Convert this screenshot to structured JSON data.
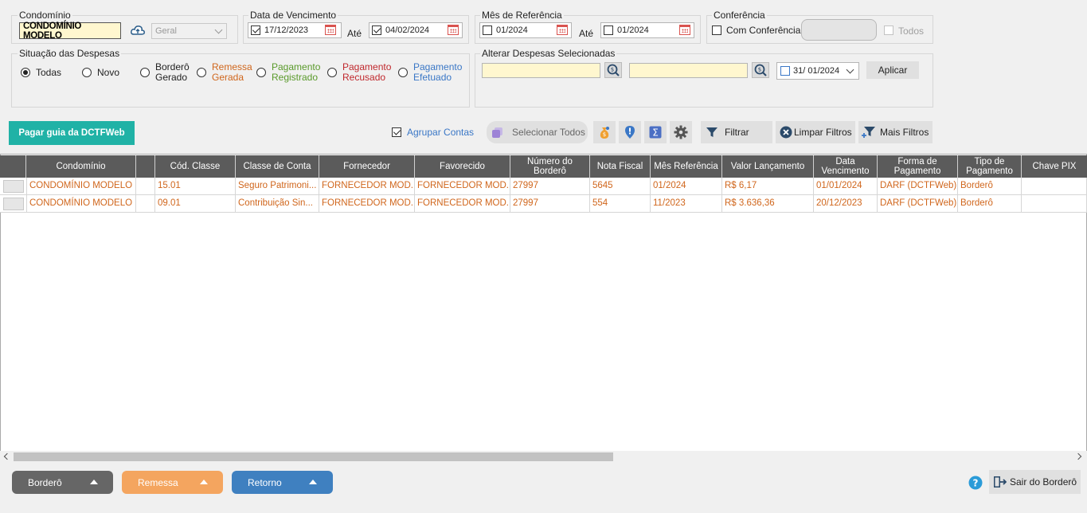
{
  "filters": {
    "condominio": {
      "label": "Condomínio",
      "value": "CONDOMÍNIO MODELO",
      "combo": "Geral"
    },
    "vencimento": {
      "label": "Data de Vencimento",
      "from": "17/12/2023",
      "ate": "Até",
      "to": "04/02/2024"
    },
    "referencia": {
      "label": "Mês de Referência",
      "from": "01/2024",
      "ate": "Até",
      "to": "01/2024"
    },
    "conferencia": {
      "label": "Conferência",
      "com": "Com Conferência",
      "todos": "Todos"
    }
  },
  "situacao": {
    "label": "Situação das Despesas",
    "options": [
      {
        "line1": "Todas",
        "line2": "",
        "color": "#222222"
      },
      {
        "line1": "Novo",
        "line2": "",
        "color": "#222222"
      },
      {
        "line1": "Borderô",
        "line2": "Gerado",
        "color": "#222222"
      },
      {
        "line1": "Remessa",
        "line2": "Gerada",
        "color": "#d0661c"
      },
      {
        "line1": "Pagamento",
        "line2": "Registrado",
        "color": "#5a9a2b"
      },
      {
        "line1": "Pagamento",
        "line2": "Recusado",
        "color": "#c0282d"
      },
      {
        "line1": "Pagamento",
        "line2": "Efetuado",
        "color": "#3a77c6"
      }
    ]
  },
  "alterar": {
    "label": "Alterar Despesas Selecionadas",
    "date": "31/ 01/2024",
    "apply": "Aplicar"
  },
  "toolbar": {
    "pagar": "Pagar guia da DCTFWeb",
    "agrupar": "Agrupar Contas",
    "selecionar": "Selecionar Todos",
    "filtrar": "Filtrar",
    "limpar": "Limpar Filtros",
    "mais": "Mais Filtros"
  },
  "grid": {
    "headers": [
      {
        "l1": "Condomínio",
        "l2": ""
      },
      {
        "l1": "",
        "l2": ""
      },
      {
        "l1": "Cód. Classe",
        "l2": ""
      },
      {
        "l1": "Classe de Conta",
        "l2": ""
      },
      {
        "l1": "Fornecedor",
        "l2": ""
      },
      {
        "l1": "Favorecido",
        "l2": ""
      },
      {
        "l1": "Número do",
        "l2": "Borderô"
      },
      {
        "l1": "Nota Fiscal",
        "l2": ""
      },
      {
        "l1": "Mês Referência",
        "l2": ""
      },
      {
        "l1": "Valor Lançamento",
        "l2": ""
      },
      {
        "l1": "Data",
        "l2": "Vencimento"
      },
      {
        "l1": "Forma de",
        "l2": "Pagamento"
      },
      {
        "l1": "Tipo de",
        "l2": "Pagamento"
      },
      {
        "l1": "Chave PIX",
        "l2": ""
      }
    ],
    "rows": [
      [
        "CONDOMÍNIO MODELO",
        "",
        "15.01",
        "Seguro Patrimoni...",
        "FORNECEDOR MOD...",
        "FORNECEDOR MOD...",
        "27997",
        "5645",
        "01/2024",
        "R$ 6,17",
        "01/01/2024",
        "DARF (DCTFWeb)",
        "Borderô",
        ""
      ],
      [
        "CONDOMÍNIO MODELO",
        "",
        "09.01",
        "Contribuição Sin...",
        "FORNECEDOR MOD...",
        "FORNECEDOR MOD...",
        "27997",
        "554",
        "11/2023",
        "R$ 3.636,36",
        "20/12/2023",
        "DARF (DCTFWeb)",
        "Borderô",
        ""
      ]
    ]
  },
  "footer": {
    "bordero": "Borderô",
    "remessa": "Remessa",
    "retorno": "Retorno",
    "sair": "Sair do Borderô"
  },
  "colors": {
    "teal": "#20b2a6",
    "bordero": "#666666",
    "remessa": "#f4a55f",
    "retorno": "#3f80c0",
    "gridHeader": "#5b5b5b",
    "rowText": "#d0661c"
  }
}
